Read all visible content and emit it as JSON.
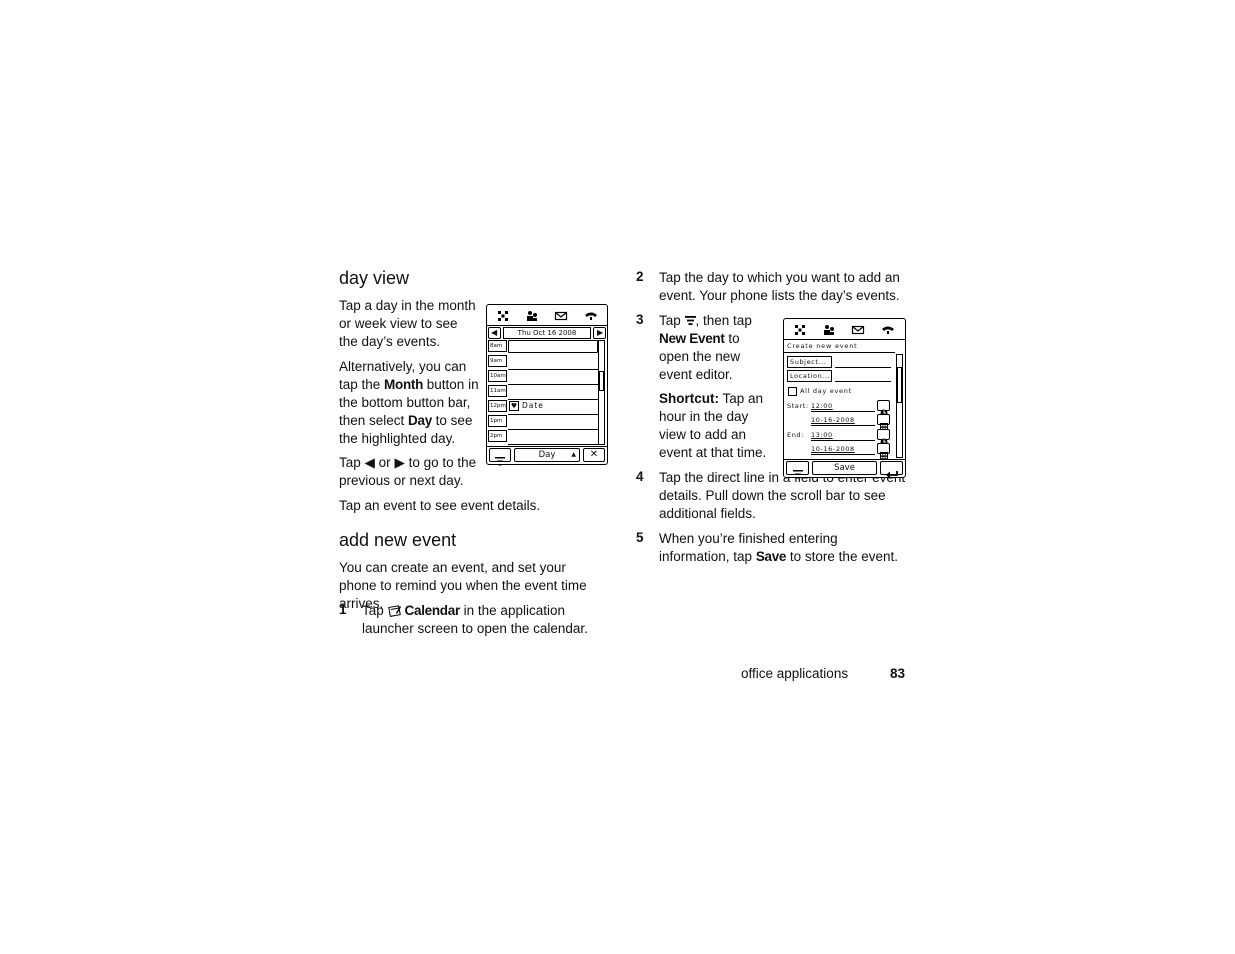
{
  "day_view": {
    "heading": "day view",
    "p1": "Tap a day in the month or week view to see the day’s events.",
    "p2_a": "Alternatively, you can tap the ",
    "p2_month": "Month",
    "p2_b": " button in the bottom button bar, then select ",
    "p2_day": "Day",
    "p2_c": " to see the highlighted day.",
    "p3_a": "Tap ",
    "p3_b": " or ",
    "p3_c": " to go to the previous or next day.",
    "p4": "Tap an event to see event details."
  },
  "add_new_event": {
    "heading": "add new event",
    "intro": "You can create an event, and set your phone to remind you when the event time arrives.",
    "step1_num": "1",
    "step1_a": "Tap ",
    "step1_calendar": "Calendar",
    "step1_b": " in the application launcher screen to open the calendar."
  },
  "steps": {
    "step2_num": "2",
    "step2": "Tap the day to which you want to add an event. Your phone lists the day’s events.",
    "step3_num": "3",
    "step3_a": "Tap ",
    "step3_b": ", then tap ",
    "step3_new_event": "New Event",
    "step3_c": " to open the new event editor.",
    "shortcut_label": "Shortcut:",
    "shortcut_text": " Tap an hour in the day view to add an event at that time.",
    "step4_num": "4",
    "step4": "Tap the direct line in a field to enter event details. Pull down the scroll bar to see additional fields.",
    "step5_num": "5",
    "step5_a": "When you’re finished entering information, tap ",
    "step5_save": "Save",
    "step5_b": " to store the event."
  },
  "phone1": {
    "date": "Thu Oct 16 2008",
    "hours": [
      "8am",
      "9am",
      "10am",
      "11am",
      "12pm",
      "1pm",
      "2pm"
    ],
    "event_label": "Date",
    "bottom_button": "Day"
  },
  "phone2": {
    "title": "Create new event",
    "subject": "Subject...",
    "location": "Location...",
    "all_day": "All day event",
    "start_label": "Start:",
    "start_time": "12:00",
    "start_date": "10-16-2008",
    "end_label": "End:",
    "end_time": "13:00",
    "end_date": "10-16-2008",
    "save_button": "Save"
  },
  "footer": {
    "section": "office applications",
    "page": "83"
  }
}
